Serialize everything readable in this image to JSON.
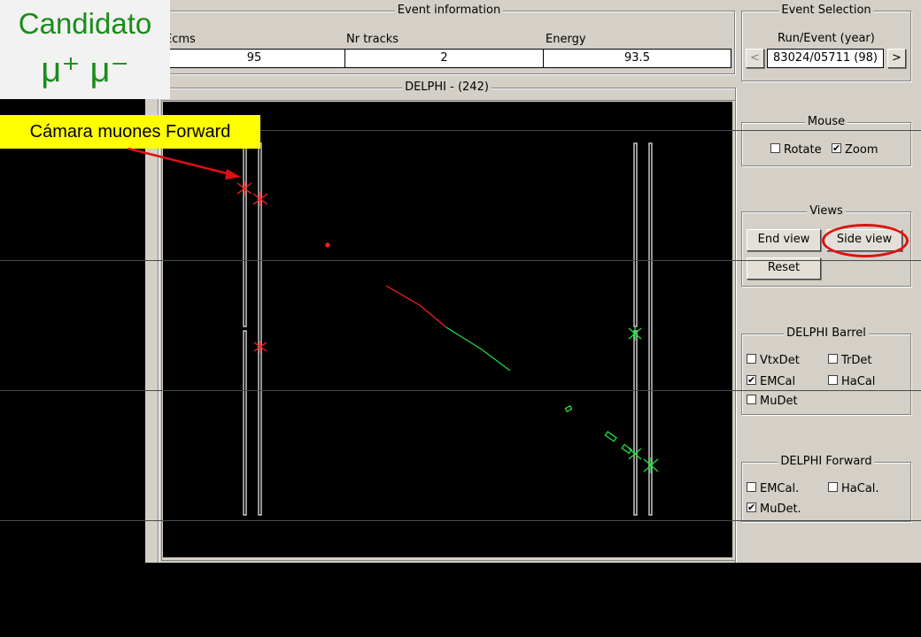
{
  "overlay": {
    "title_line1": "Candidato",
    "title_line2": "μ⁺ μ⁻",
    "callout_label": "Cámara muones Forward"
  },
  "event_info": {
    "legend": "Event information",
    "fields": [
      {
        "label": "Ecms",
        "value": "95"
      },
      {
        "label": "Nr tracks",
        "value": "2"
      },
      {
        "label": "Energy",
        "value": "93.5"
      }
    ]
  },
  "display": {
    "legend": "DELPHI - (242)"
  },
  "event_selection": {
    "legend": "Event Selection",
    "label": "Run/Event  (year)",
    "prev_label": "<",
    "value": "83024/05711   (98)",
    "next_label": ">"
  },
  "mouse": {
    "legend": "Mouse",
    "rotate": {
      "label": "Rotate",
      "checked": false
    },
    "zoom": {
      "label": "Zoom",
      "checked": true
    }
  },
  "views": {
    "legend": "Views",
    "end_view": "End view",
    "side_view": "Side view",
    "reset": "Reset",
    "highlight_color": "#e01010"
  },
  "barrel": {
    "legend": "DELPHI Barrel",
    "vtxdet": {
      "label": "VtxDet",
      "checked": false
    },
    "trdet": {
      "label": "TrDet",
      "checked": false
    },
    "emcal": {
      "label": "EMCal",
      "checked": true
    },
    "hacal": {
      "label": "HaCal",
      "checked": false
    },
    "mudet": {
      "label": "MuDet",
      "checked": false
    }
  },
  "forward": {
    "legend": "DELPHI Forward",
    "emcal": {
      "label": "EMCal.",
      "checked": false
    },
    "hacal": {
      "label": "HaCal.",
      "checked": false
    },
    "mudet": {
      "label": "MuDet.",
      "checked": true
    }
  },
  "colors": {
    "track_red": "#ff2020",
    "track_green": "#20e040",
    "detector_outline": "#c8c8c8"
  }
}
